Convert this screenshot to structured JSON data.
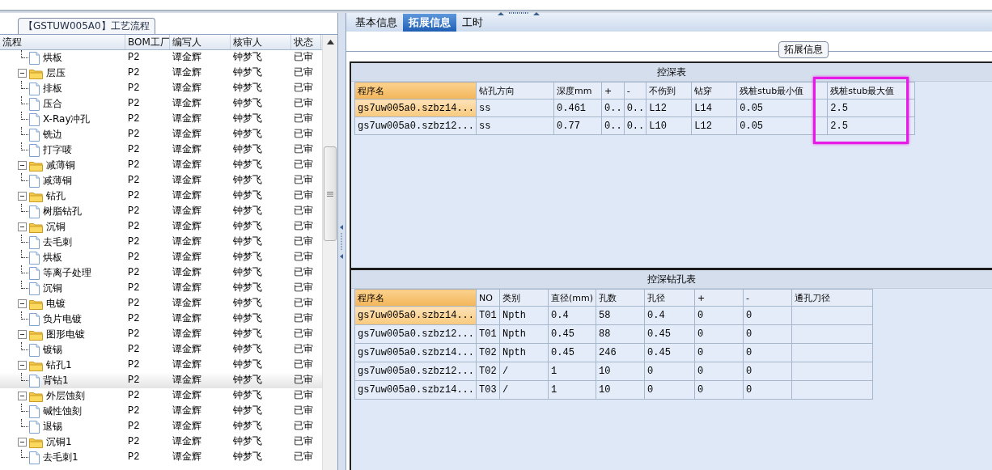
{
  "left_panel": {
    "title": "【GSTUW005A0】工艺流程",
    "columns": [
      "流程",
      "BOM工厂",
      "编写人",
      "核审人",
      "状态"
    ],
    "items": [
      {
        "children": [
          {
            "label": "烘板",
            "kind": "file",
            "selected": false,
            "cells": [
              "P2",
              "谭金辉",
              "钟梦飞",
              "已审"
            ]
          }
        ]
      },
      {
        "label": "层压",
        "kind": "folder",
        "expanded": true,
        "selected": false,
        "cells": [
          "P2",
          "谭金辉",
          "钟梦飞",
          "已审"
        ],
        "children": [
          {
            "label": "排板",
            "kind": "file",
            "selected": false,
            "cells": [
              "P2",
              "谭金辉",
              "钟梦飞",
              "已审"
            ]
          },
          {
            "label": "压合",
            "kind": "file",
            "selected": false,
            "cells": [
              "P2",
              "谭金辉",
              "钟梦飞",
              "已审"
            ]
          },
          {
            "label": "X-Ray冲孔",
            "kind": "file",
            "selected": false,
            "cells": [
              "P2",
              "谭金辉",
              "钟梦飞",
              "已审"
            ]
          },
          {
            "label": "铣边",
            "kind": "file",
            "selected": false,
            "cells": [
              "P2",
              "谭金辉",
              "钟梦飞",
              "已审"
            ]
          },
          {
            "label": "打字唛",
            "kind": "file",
            "selected": false,
            "cells": [
              "P2",
              "谭金辉",
              "钟梦飞",
              "已审"
            ]
          }
        ]
      },
      {
        "label": "减薄铜",
        "kind": "folder",
        "expanded": true,
        "selected": false,
        "cells": [
          "P2",
          "谭金辉",
          "钟梦飞",
          "已审"
        ],
        "children": [
          {
            "label": "减薄铜",
            "kind": "file",
            "selected": false,
            "cells": [
              "P2",
              "谭金辉",
              "钟梦飞",
              "已审"
            ]
          }
        ]
      },
      {
        "label": "钻孔",
        "kind": "folder",
        "expanded": true,
        "selected": false,
        "cells": [
          "P2",
          "谭金辉",
          "钟梦飞",
          "已审"
        ],
        "children": [
          {
            "label": "树脂钻孔",
            "kind": "file",
            "selected": false,
            "cells": [
              "P2",
              "谭金辉",
              "钟梦飞",
              "已审"
            ]
          }
        ]
      },
      {
        "label": "沉铜",
        "kind": "folder",
        "expanded": true,
        "selected": false,
        "cells": [
          "P2",
          "谭金辉",
          "钟梦飞",
          "已审"
        ],
        "children": [
          {
            "label": "去毛刺",
            "kind": "file",
            "selected": false,
            "cells": [
              "P2",
              "谭金辉",
              "钟梦飞",
              "已审"
            ]
          },
          {
            "label": "烘板",
            "kind": "file",
            "selected": false,
            "cells": [
              "P2",
              "谭金辉",
              "钟梦飞",
              "已审"
            ]
          },
          {
            "label": "等离子处理",
            "kind": "file",
            "selected": false,
            "cells": [
              "P2",
              "谭金辉",
              "钟梦飞",
              "已审"
            ]
          },
          {
            "label": "沉铜",
            "kind": "file",
            "selected": false,
            "cells": [
              "P2",
              "谭金辉",
              "钟梦飞",
              "已审"
            ]
          }
        ]
      },
      {
        "label": "电镀",
        "kind": "folder",
        "expanded": true,
        "selected": false,
        "cells": [
          "P2",
          "谭金辉",
          "钟梦飞",
          "已审"
        ],
        "children": [
          {
            "label": "负片电镀",
            "kind": "file",
            "selected": false,
            "cells": [
              "P2",
              "谭金辉",
              "钟梦飞",
              "已审"
            ]
          }
        ]
      },
      {
        "label": "图形电镀",
        "kind": "folder",
        "expanded": true,
        "selected": false,
        "cells": [
          "P2",
          "谭金辉",
          "钟梦飞",
          "已审"
        ],
        "children": [
          {
            "label": "镀锡",
            "kind": "file",
            "selected": false,
            "cells": [
              "P2",
              "谭金辉",
              "钟梦飞",
              "已审"
            ]
          }
        ]
      },
      {
        "label": "钻孔1",
        "kind": "folder",
        "expanded": true,
        "selected": false,
        "cells": [
          "P2",
          "谭金辉",
          "钟梦飞",
          "已审"
        ],
        "children": [
          {
            "label": "背钻1",
            "kind": "file",
            "selected": true,
            "cells": [
              "P2",
              "谭金辉",
              "钟梦飞",
              "已审"
            ]
          }
        ]
      },
      {
        "label": "外层蚀刻",
        "kind": "folder",
        "expanded": true,
        "selected": false,
        "cells": [
          "P2",
          "谭金辉",
          "钟梦飞",
          "已审"
        ],
        "children": [
          {
            "label": "碱性蚀刻",
            "kind": "file",
            "selected": false,
            "cells": [
              "P2",
              "谭金辉",
              "钟梦飞",
              "已审"
            ]
          },
          {
            "label": "退锡",
            "kind": "file",
            "selected": false,
            "cells": [
              "P2",
              "谭金辉",
              "钟梦飞",
              "已审"
            ]
          }
        ]
      },
      {
        "label": "沉铜1",
        "kind": "folder",
        "expanded": true,
        "selected": false,
        "cells": [
          "P2",
          "谭金辉",
          "钟梦飞",
          "已审"
        ],
        "children": [
          {
            "label": "去毛刺1",
            "kind": "file",
            "selected": false,
            "cells": [
              "P2",
              "谭金辉",
              "钟梦飞",
              "已审"
            ]
          }
        ]
      }
    ]
  },
  "right_panel": {
    "tabs": [
      {
        "label": "基本信息",
        "selected": false
      },
      {
        "label": "拓展信息",
        "selected": true
      },
      {
        "label": "工时",
        "selected": false
      }
    ],
    "group_title": "拓展信息",
    "depth_table": {
      "title": "控深表",
      "columns": [
        {
          "label": "程序名",
          "highlighted": false
        },
        {
          "label": "钻孔方向",
          "highlighted": false
        },
        {
          "label": "深度mm",
          "highlighted": false
        },
        {
          "label": "+",
          "highlighted": false
        },
        {
          "label": "-",
          "highlighted": false
        },
        {
          "label": "不伤到",
          "highlighted": false
        },
        {
          "label": "钻穿",
          "highlighted": false
        },
        {
          "label": "残桩stub最小值",
          "highlighted": false
        },
        {
          "label": "残桩stub最大值",
          "highlighted": true
        }
      ],
      "rows": [
        {
          "selected": true,
          "cells": [
            "gs7uw005a0.szbz14...",
            "ss",
            "0.461",
            "0..",
            "0..",
            "L12",
            "L14",
            "0.05",
            "2.5"
          ]
        },
        {
          "selected": false,
          "cells": [
            "gs7uw005a0.szbz12...",
            "ss",
            "0.77",
            "0..",
            "0..",
            "L10",
            "L12",
            "0.05",
            "2.5"
          ]
        }
      ]
    },
    "drill_table": {
      "title": "控深钻孔表",
      "columns": [
        {
          "label": "程序名",
          "highlighted": false
        },
        {
          "label": "NO",
          "highlighted": false
        },
        {
          "label": "类别",
          "highlighted": false
        },
        {
          "label": "直径(mm)",
          "highlighted": false
        },
        {
          "label": "孔数",
          "highlighted": false
        },
        {
          "label": "孔径",
          "highlighted": false
        },
        {
          "label": "+",
          "highlighted": false
        },
        {
          "label": "-",
          "highlighted": false
        },
        {
          "label": "通孔刀径",
          "highlighted": false
        }
      ],
      "rows": [
        {
          "selected": true,
          "cells": [
            "gs7uw005a0.szbz14...",
            "T01",
            "Npth",
            "0.4",
            "58",
            "0.4",
            "0",
            "0",
            ""
          ]
        },
        {
          "selected": false,
          "cells": [
            "gs7uw005a0.szbz12...",
            "T01",
            "Npth",
            "0.45",
            "88",
            "0.45",
            "0",
            "0",
            ""
          ]
        },
        {
          "selected": false,
          "cells": [
            "gs7uw005a0.szbz14...",
            "T02",
            "Npth",
            "0.45",
            "246",
            "0.45",
            "0",
            "0",
            ""
          ]
        },
        {
          "selected": false,
          "cells": [
            "gs7uw005a0.szbz12...",
            "T02",
            "/",
            "1",
            "10",
            "0",
            "0",
            "0",
            ""
          ]
        },
        {
          "selected": false,
          "cells": [
            "gs7uw005a0.szbz14...",
            "T03",
            "/",
            "1",
            "10",
            "0",
            "0",
            "0",
            ""
          ]
        }
      ]
    }
  }
}
